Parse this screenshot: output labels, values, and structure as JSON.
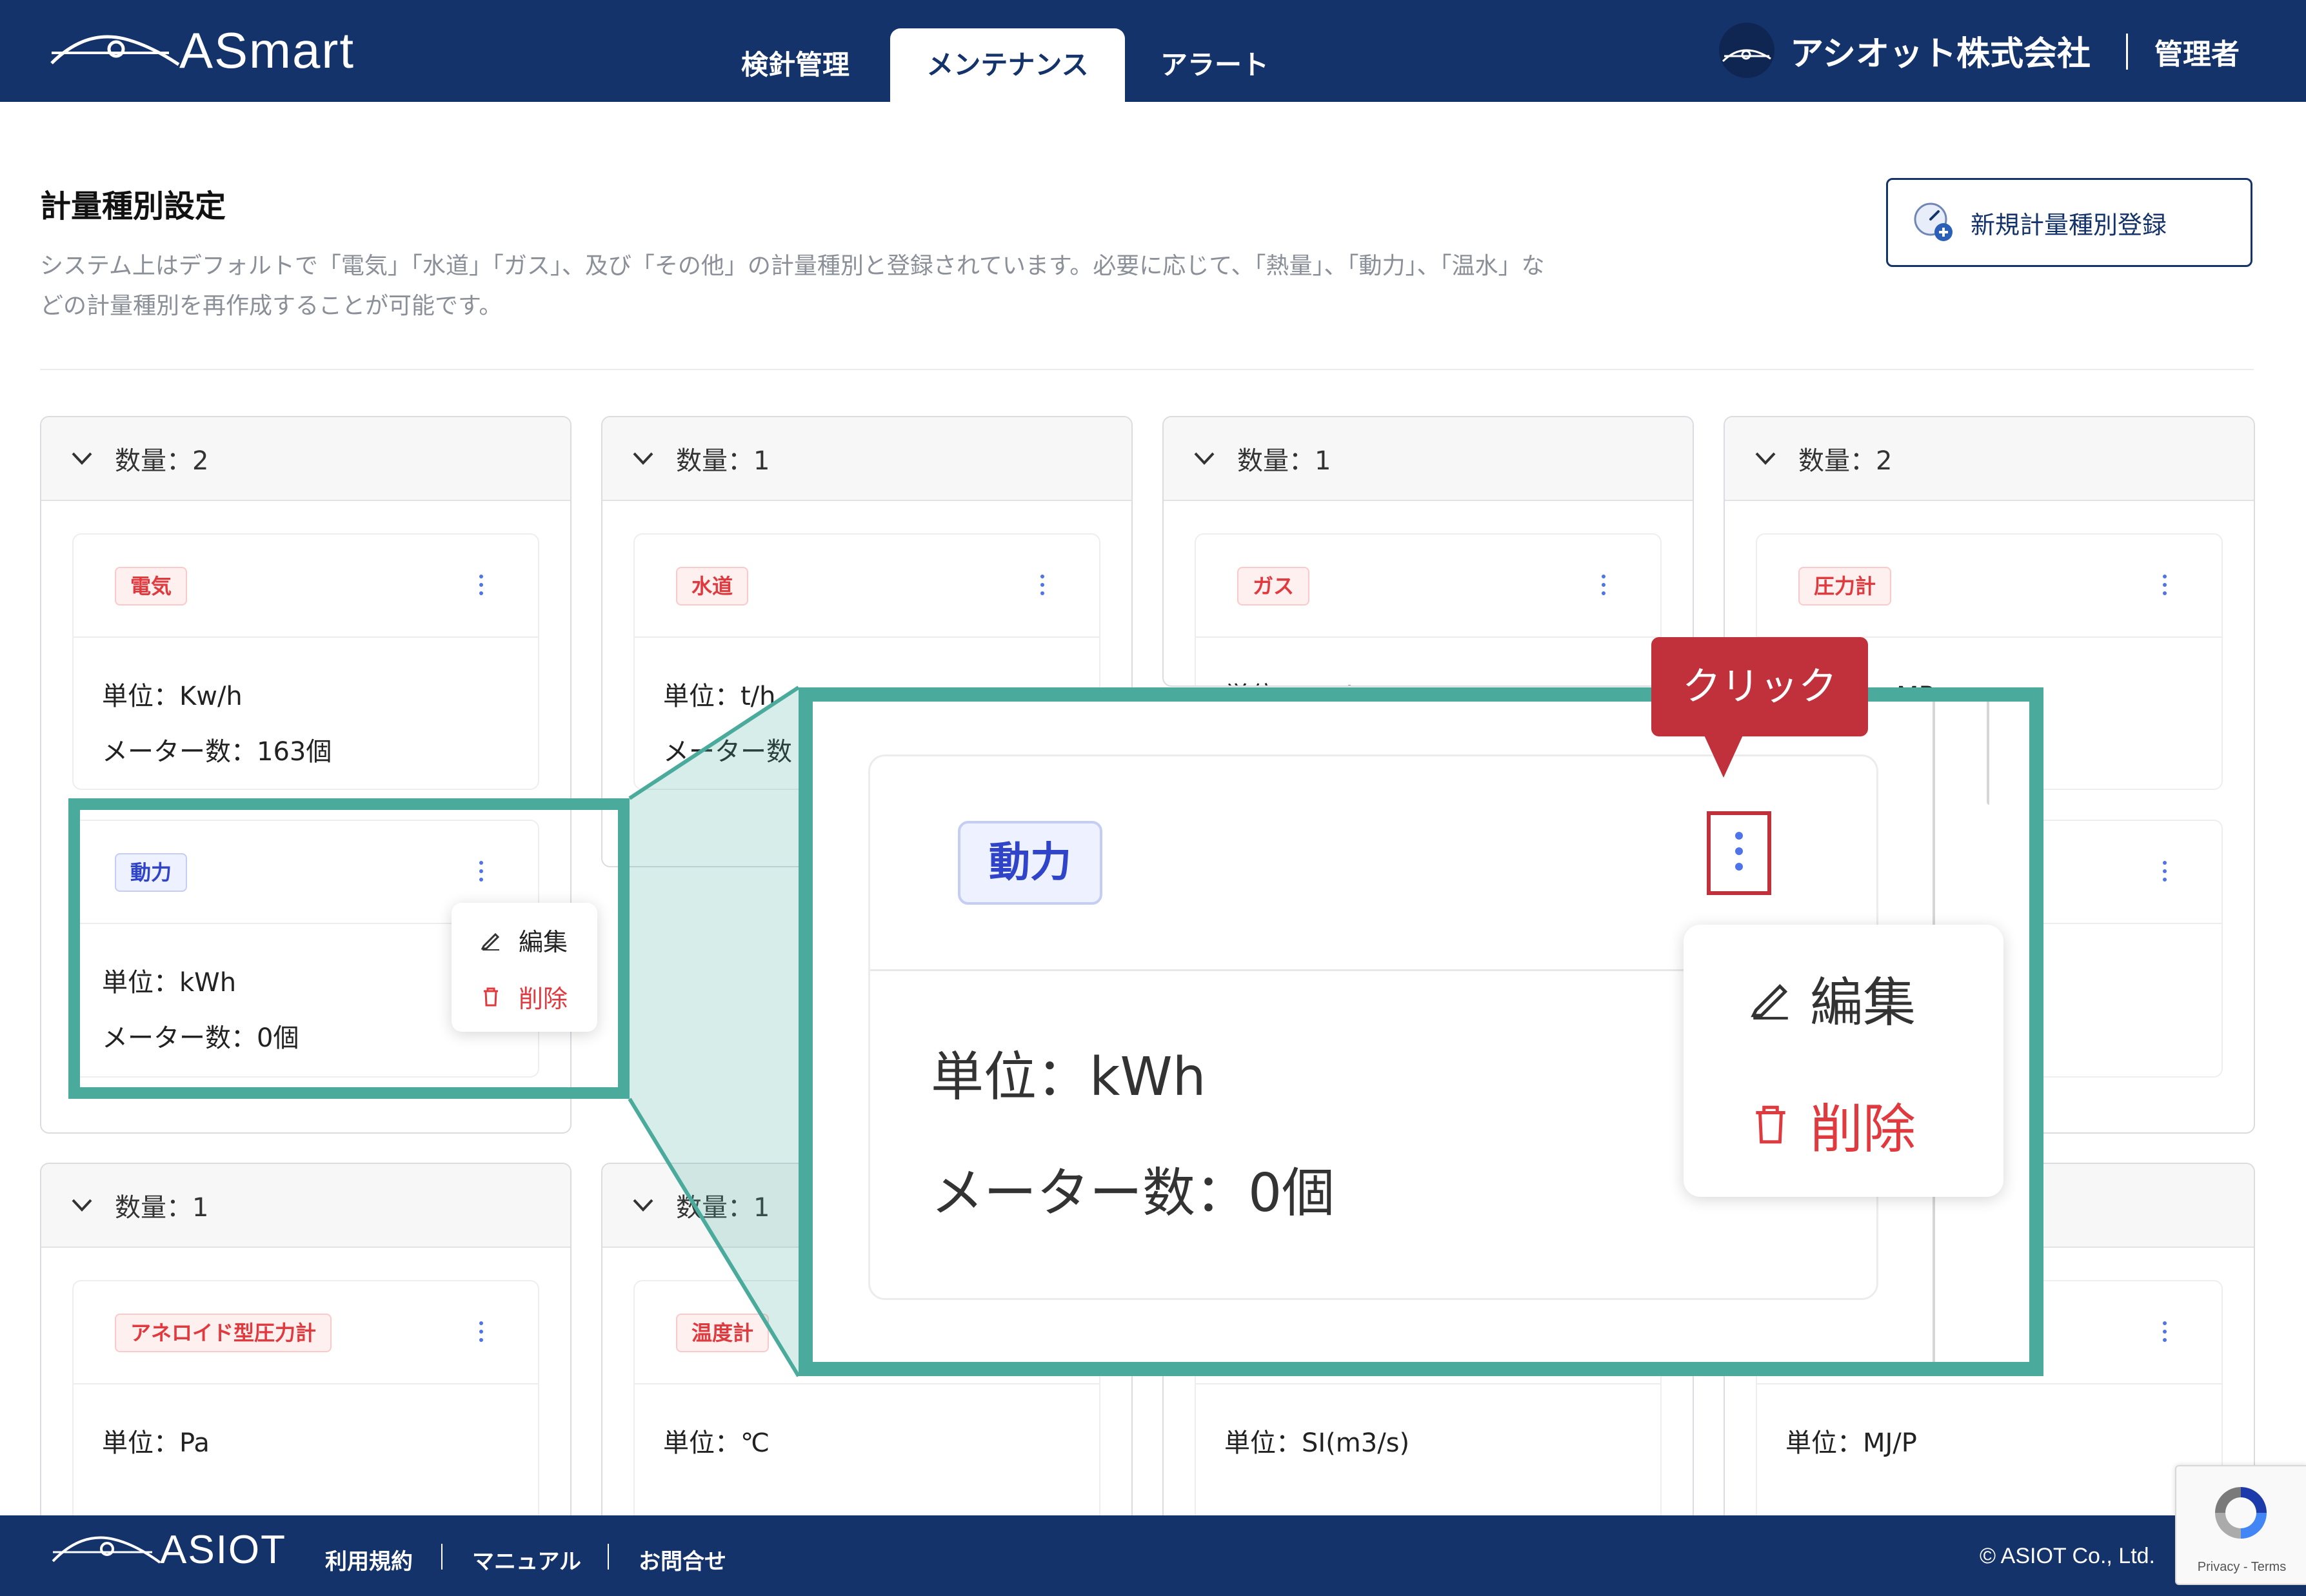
{
  "header": {
    "logo_text": "ASmart",
    "tabs": [
      {
        "label": "検針管理",
        "active": false
      },
      {
        "label": "メンテナンス",
        "active": true
      },
      {
        "label": "アラート",
        "active": false
      }
    ],
    "company": "アシオット株式会社",
    "role": "管理者",
    "bg_color": "#15336b"
  },
  "page": {
    "title": "計量種別設定",
    "description_line1": "システム上はデフォルトで「電気」「水道」「ガス」、及び「その他」の計量種別と登録されています。必要に応じて、「熱量」、「動力」、「温水」な",
    "description_line2": "どの計量種別を再作成することが可能です。",
    "new_button_label": "新規計量種別登録"
  },
  "groups": [
    {
      "count_label": "数量：2"
    },
    {
      "count_label": "数量：1"
    },
    {
      "count_label": "数量：1"
    },
    {
      "count_label": "数量：2"
    },
    {
      "count_label": "数量：1"
    },
    {
      "count_label": "数量：1"
    }
  ],
  "cards": [
    {
      "tag": "電気",
      "unit": "単位：Kw/h",
      "meters": "メーター数：163個"
    },
    {
      "tag": "水道",
      "unit": "単位：t/h",
      "meters": "メーター数"
    },
    {
      "tag": "ガス",
      "unit": "単位：m³/h"
    },
    {
      "tag": "圧力計",
      "unit": "MPa"
    },
    {
      "tag": "動力",
      "unit": "単位：kWh",
      "meters": "メーター数：0個"
    },
    {
      "tag": "アネロイド型圧力計",
      "unit": "単位：Pa"
    },
    {
      "tag": "温度計",
      "unit": "単位：℃"
    },
    {
      "unit": "単位：SI(m3/s)"
    },
    {
      "unit": "単位：MJ/P"
    }
  ],
  "menu": {
    "edit": "編集",
    "delete": "削除"
  },
  "callout": "クリック",
  "footer": {
    "logo_text": "ASIOT",
    "links": [
      "利用規約",
      "マニュアル",
      "お問合せ"
    ],
    "copyright": "© ASIOT Co., Ltd."
  },
  "recaptcha": {
    "text": "Privacy - Terms"
  },
  "colors": {
    "accent_teal": "#4aab9c",
    "danger_red": "#e0393e",
    "callout_red": "#c0313b",
    "kebab_blue": "#4f73e8"
  }
}
